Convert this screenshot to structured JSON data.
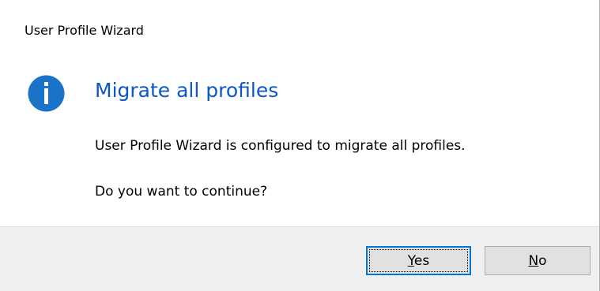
{
  "window": {
    "title": "User Profile Wizard"
  },
  "content": {
    "icon": "info-icon",
    "heading": "Migrate all profiles",
    "message_line1": "User Profile Wizard is configured to migrate all profiles.",
    "message_line2": "Do you want to continue?"
  },
  "buttons": {
    "yes": {
      "mnemonic": "Y",
      "rest": "es"
    },
    "no": {
      "mnemonic": "N",
      "rest": "o"
    }
  },
  "colors": {
    "heading": "#0c56c9",
    "icon": "#1a73c9",
    "footer_bg": "#f0f0f0",
    "default_button_border": "#0078d7"
  }
}
